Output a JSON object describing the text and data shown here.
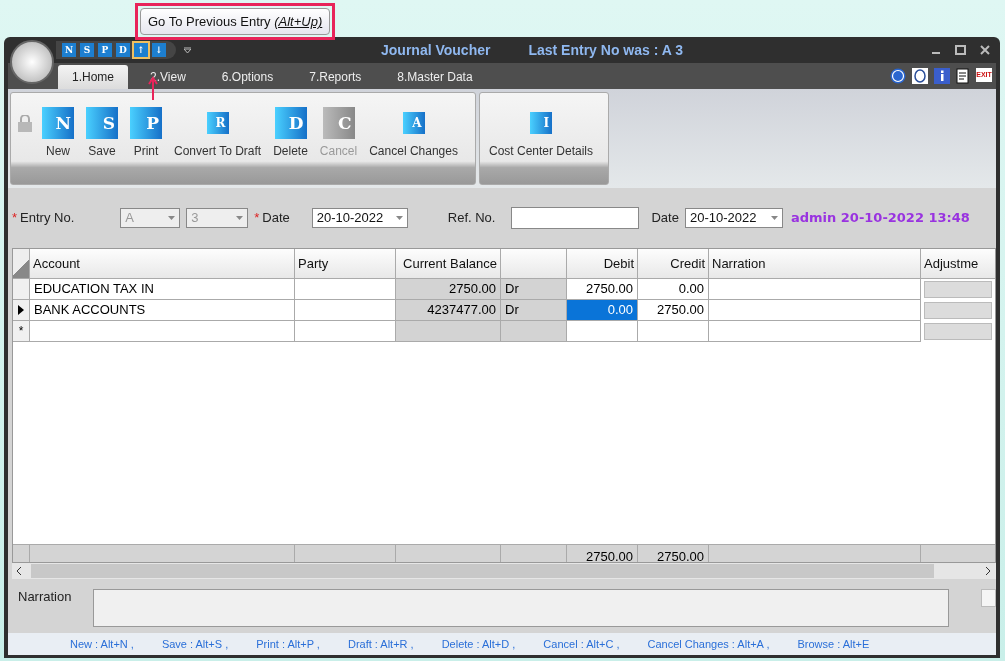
{
  "tooltip": {
    "text": "Go To Previous Entry",
    "shortcut": "(Alt+Up)"
  },
  "window": {
    "title": "Journal Voucher",
    "last_entry": "Last Entry No was : A 3"
  },
  "quick_access": [
    {
      "glyph": "N",
      "selected": false
    },
    {
      "glyph": "S",
      "selected": false
    },
    {
      "glyph": "P",
      "selected": false
    },
    {
      "glyph": "D",
      "selected": false
    },
    {
      "glyph": "↑",
      "selected": true
    },
    {
      "glyph": "↓",
      "selected": false
    }
  ],
  "tabs": [
    {
      "label": "1.Home",
      "selected": true
    },
    {
      "label": "2.View",
      "selected": false
    },
    {
      "label": "6.Options",
      "selected": false
    },
    {
      "label": "7.Reports",
      "selected": false
    },
    {
      "label": "8.Master Data",
      "selected": false
    }
  ],
  "exit_label": "EXIT",
  "ribbon": [
    {
      "label": "New",
      "glyph": "N",
      "disabled": false
    },
    {
      "label": "Save",
      "glyph": "S",
      "disabled": false
    },
    {
      "label": "Print",
      "glyph": "P",
      "disabled": false
    },
    {
      "label": "Convert To Draft",
      "glyph": "R",
      "disabled": false
    },
    {
      "label": "Delete",
      "glyph": "D",
      "disabled": false
    },
    {
      "label": "Cancel",
      "glyph": "C",
      "disabled": true
    },
    {
      "label": "Cancel Changes",
      "glyph": "A",
      "disabled": false
    }
  ],
  "ribbon_extra": {
    "label": "Cost Center Details",
    "glyph": "I"
  },
  "form": {
    "entry_label": "Entry No.",
    "series": "A",
    "number": "3",
    "date_label": "Date",
    "date": "20-10-2022",
    "ref_label": "Ref. No.",
    "date2_label": "Date",
    "date2": "20-10-2022",
    "audit": "admin 20-10-2022 13:48"
  },
  "columns": [
    {
      "label": "Account",
      "readonly": false
    },
    {
      "label": "Party",
      "readonly": false
    },
    {
      "label": "Current Balance",
      "readonly": true
    },
    {
      "readonly": true
    },
    {
      "label": "Debit",
      "readonly": false,
      "total": "2750.00"
    },
    {
      "label": "Credit",
      "readonly": false,
      "total": "2750.00"
    },
    {
      "label": "Narration",
      "readonly": false
    },
    {
      "label": "Adjustme",
      "readonly": true
    }
  ],
  "rows": [
    {
      "kind": "entry",
      "selected": false,
      "cells": [
        {
          "text": "EDUCATION TAX IN",
          "selected": false
        },
        {
          "selected": false
        },
        {
          "text": "2750.00",
          "selected": false
        },
        {
          "text": "Dr",
          "selected": false
        },
        {
          "text": "2750.00",
          "selected": false
        },
        {
          "text": "0.00",
          "selected": false
        },
        {
          "selected": false
        },
        {
          "selected": false
        }
      ]
    },
    {
      "kind": "entry",
      "selected": true,
      "cells": [
        {
          "text": "BANK ACCOUNTS",
          "selected": false
        },
        {
          "selected": false
        },
        {
          "text": "4237477.00",
          "selected": false
        },
        {
          "text": "Dr",
          "selected": false
        },
        {
          "text": "0.00",
          "selected": true
        },
        {
          "text": "2750.00",
          "selected": false
        },
        {
          "selected": false
        },
        {
          "selected": false
        }
      ]
    },
    {
      "kind": "new",
      "glyph": "*"
    }
  ],
  "narration_label": "Narration",
  "narration_check": {
    "checked": false
  },
  "shortcuts": [
    "New : Alt+N ,",
    "Save : Alt+S ,",
    "Print : Alt+P ,",
    "Draft : Alt+R ,",
    "Delete : Alt+D ,",
    "Cancel : Alt+C ,",
    "Cancel Changes : Alt+A ,",
    "Browse : Alt+E"
  ]
}
